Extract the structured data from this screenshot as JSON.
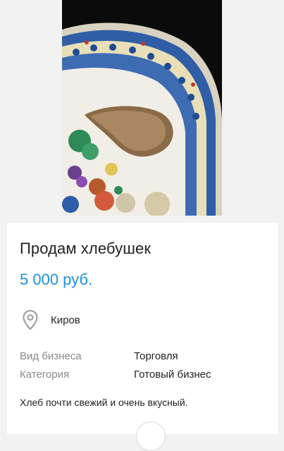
{
  "listing": {
    "title": "Продам хлебушек",
    "price": "5 000 руб.",
    "location": "Киров",
    "details": [
      {
        "label": "Вид бизнеса",
        "value": "Торговля"
      },
      {
        "label": "Категория",
        "value": "Готовый бизнес"
      }
    ],
    "description": "Хлеб почти свежий и очень вкусный."
  },
  "icons": {
    "location": "map-pin-icon"
  },
  "colors": {
    "price": "#1e91e0",
    "background": "#f2f2f2",
    "card": "#ffffff"
  }
}
